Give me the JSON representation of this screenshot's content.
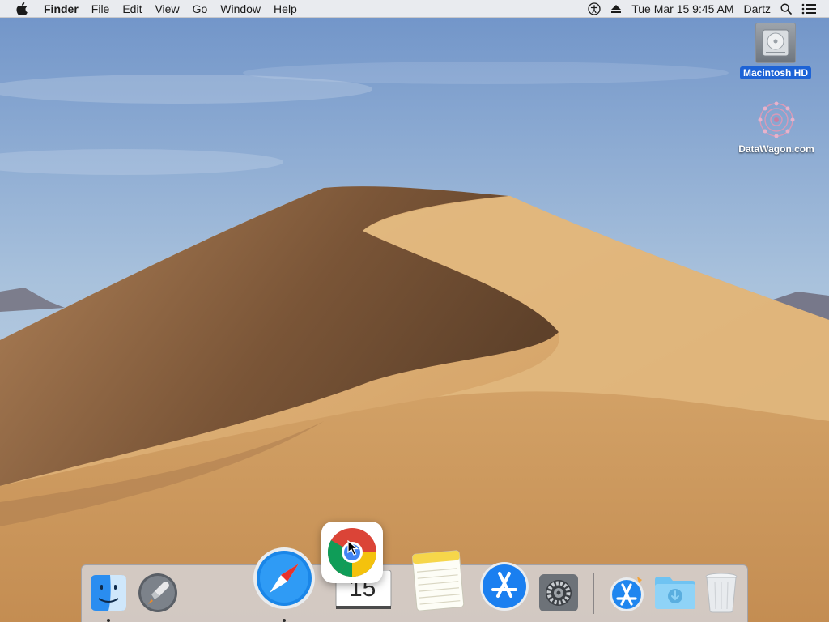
{
  "menubar": {
    "app_name": "Finder",
    "items": [
      "File",
      "Edit",
      "View",
      "Go",
      "Window",
      "Help"
    ],
    "datetime": "Tue Mar 15  9:45 AM",
    "user": "Dartz",
    "icons": {
      "apple": "apple-logo-icon",
      "accessibility": "accessibility-icon",
      "eject": "eject-icon",
      "search": "spotlight-search-icon",
      "notifications": "notification-center-icon"
    }
  },
  "desktop": {
    "icons": [
      {
        "label": "Macintosh HD",
        "icon": "hard-drive-icon",
        "selected": true
      },
      {
        "label": "DataWagon.com",
        "icon": "mandala-icon",
        "selected": false
      }
    ]
  },
  "dock": {
    "apps": [
      {
        "name": "Finder",
        "icon": "finder-icon",
        "running": true
      },
      {
        "name": "Launchpad",
        "icon": "launchpad-icon",
        "running": false
      },
      {
        "name": "Safari",
        "icon": "safari-icon",
        "running": true
      },
      {
        "name": "Calendar",
        "icon": "calendar-icon",
        "running": false,
        "day": "15"
      },
      {
        "name": "Notes",
        "icon": "notes-icon",
        "running": false
      },
      {
        "name": "App Store",
        "icon": "app-store-icon",
        "running": false
      },
      {
        "name": "System Preferences",
        "icon": "system-preferences-icon",
        "running": false
      },
      {
        "name": "Applications",
        "icon": "applications-folder-icon",
        "running": false
      },
      {
        "name": "Downloads",
        "icon": "downloads-folder-icon",
        "running": false
      },
      {
        "name": "Trash",
        "icon": "trash-icon",
        "running": false
      }
    ],
    "dragging": {
      "name": "Google Chrome",
      "icon": "chrome-icon"
    }
  },
  "colors": {
    "selection": "#1d63d6",
    "menubar_bg": "#eeeef0",
    "sky_top": "#6f93c8",
    "sky_bottom": "#d5e0e7",
    "dune_light": "#dcae73",
    "dune_shadow": "#6a4a30"
  }
}
